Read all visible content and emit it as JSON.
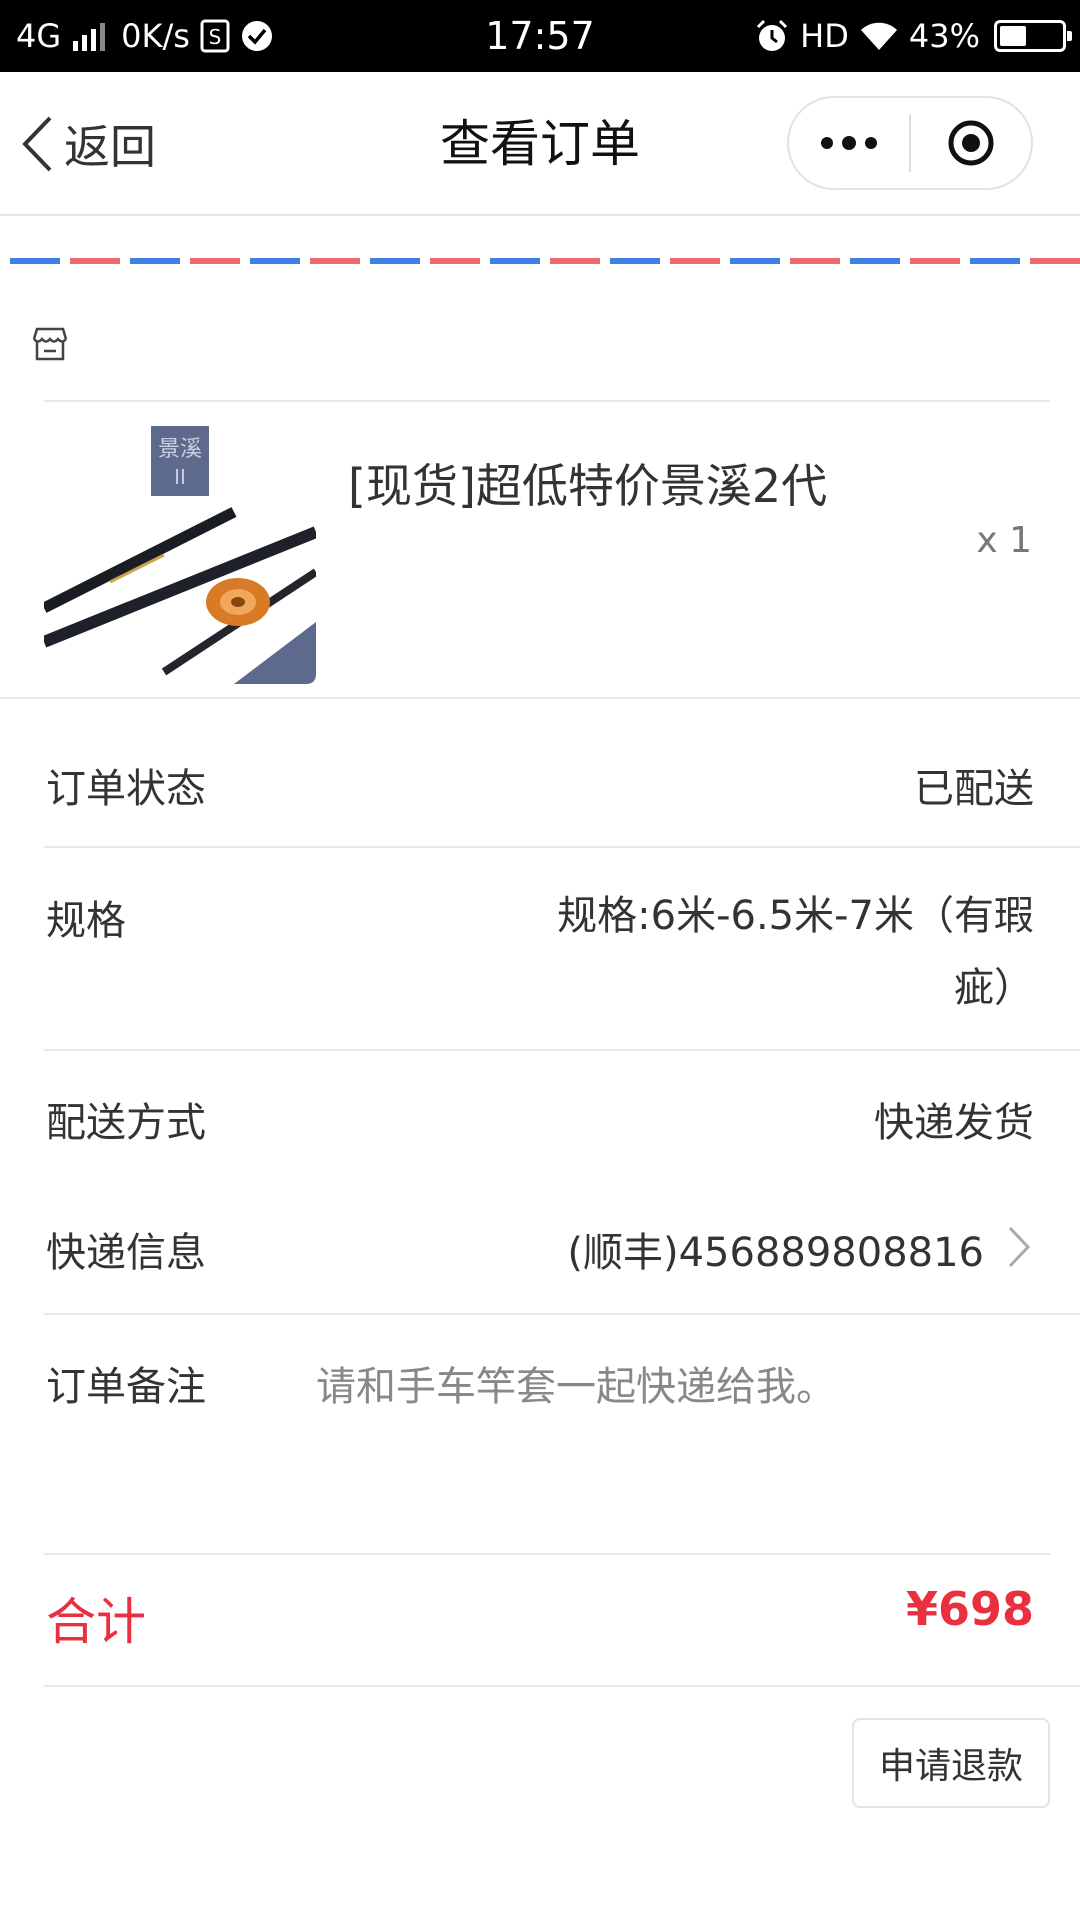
{
  "status_bar": {
    "network": "4G",
    "speed": "0K/s",
    "time": "17:57",
    "hd": "HD",
    "battery_text": "43%",
    "battery_level": 0.43
  },
  "nav": {
    "back_label": "返回",
    "title": "查看订单"
  },
  "product": {
    "name": "[现货]超低特价景溪2代",
    "quantity": "x 1",
    "image_badge_line1": "景溪",
    "image_badge_line2": "II"
  },
  "order": {
    "status_label": "订单状态",
    "status_value": "已配送",
    "spec_label": "规格",
    "spec_value": "规格:6米-6.5米-7米（有瑕疵）",
    "delivery_label": "配送方式",
    "delivery_value": "快递发货",
    "express_label": "快递信息",
    "express_value": "(顺丰)456889808816",
    "remark_label": "订单备注",
    "remark_value": "请和手车竿套一起快递给我。"
  },
  "total": {
    "label": "合计",
    "value": "¥698"
  },
  "actions": {
    "refund_label": "申请退款"
  },
  "colors": {
    "accent_red": "#e8303e",
    "stripe_blue": "#3f7fe6",
    "stripe_red": "#ef6a6a"
  }
}
